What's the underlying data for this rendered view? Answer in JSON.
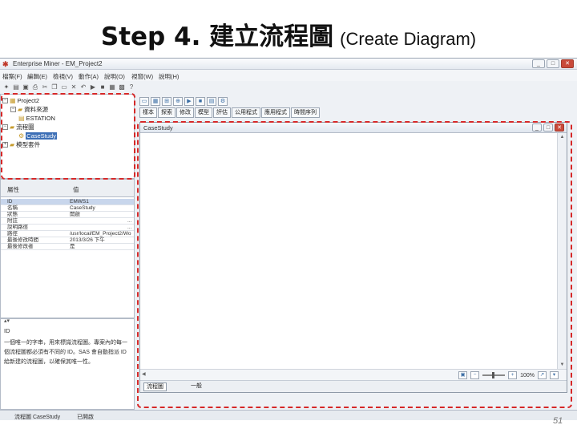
{
  "slide": {
    "title_main": "Step 4. 建立流程圖",
    "title_sub": "(Create Diagram)",
    "page_number": "51"
  },
  "app": {
    "window_title": "Enterprise Miner - EM_Project2",
    "menu": [
      "檔案(F)",
      "編輯(E)",
      "檢視(V)",
      "動作(A)",
      "說明(O)",
      "視窗(W)",
      "說明(H)"
    ],
    "toolbar_icons": [
      "new-icon",
      "open-icon",
      "save-icon",
      "print-icon",
      "cut-icon",
      "copy-icon",
      "paste-icon",
      "delete-icon",
      "undo-icon",
      "run-icon",
      "stop-icon",
      "results-icon",
      "grid-icon",
      "help-icon"
    ]
  },
  "project_tree": {
    "items": [
      {
        "label": "Project2",
        "level": 0
      },
      {
        "label": "資料來源",
        "level": 1
      },
      {
        "label": "ESTATION",
        "level": 2
      },
      {
        "label": "流程圖",
        "level": 1
      },
      {
        "label": "CaseStudy",
        "level": 2,
        "selected": true
      },
      {
        "label": "模型套件",
        "level": 0
      }
    ]
  },
  "properties": {
    "col_property": "屬性",
    "col_value": "值",
    "rows": [
      {
        "name": "ID",
        "value": "EMWS1",
        "highlight": true
      },
      {
        "name": "名稱",
        "value": "CaseStudy",
        "highlight": false
      },
      {
        "name": "狀態",
        "value": "開啟",
        "highlight": false
      },
      {
        "name": "附註",
        "value": "",
        "button": "...",
        "highlight": false
      },
      {
        "name": "說明路徑",
        "value": "",
        "button": "...",
        "highlight": false
      },
      {
        "name": "路徑",
        "value": "/usr/local/EM_Project2/Wo",
        "highlight": false
      },
      {
        "name": "最後修改時間",
        "value": "2013/3/26 下午",
        "highlight": false
      },
      {
        "name": "最後修改者",
        "value": "是",
        "highlight": false
      }
    ]
  },
  "description": {
    "title": "ID",
    "text": "一個唯一的字串，用來標識流程圖。專案內的每一個流程圖都必須有不同的 ID。SAS 會自動指派 ID 給新建的流程圖，以確保其唯一性。"
  },
  "status_bar": {
    "diagram_label": "流程圖 CaseStudy",
    "status": "已開啟"
  },
  "diagram_toolbar": {
    "icons": [
      "select-icon",
      "grid-icon",
      "layout-icon",
      "zoom-icon",
      "run-icon",
      "stop-icon",
      "results-icon",
      "settings-icon"
    ],
    "category_tabs": [
      "樣本",
      "探索",
      "修改",
      "模型",
      "評估",
      "公用程式",
      "應用程式",
      "時間序列"
    ]
  },
  "diagram_window": {
    "title": "CaseStudy",
    "zoom_label": "100%",
    "diagram_tab": "流程圖",
    "diagram_tab2": "一般"
  },
  "highlight": {
    "color": "#d62828"
  }
}
